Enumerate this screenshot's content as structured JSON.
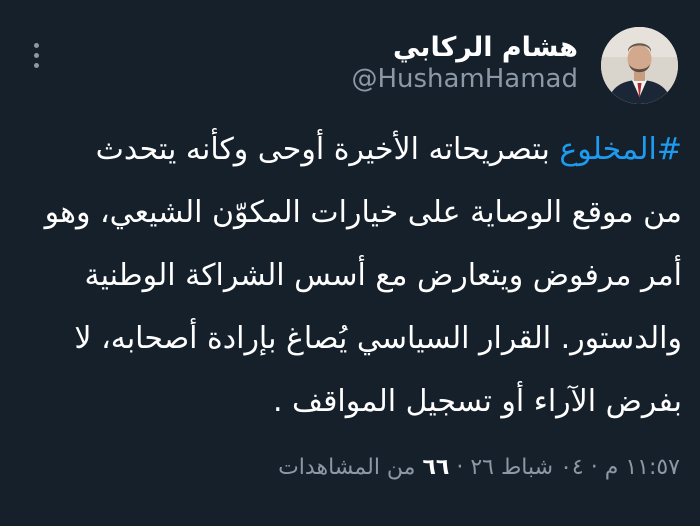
{
  "author": {
    "display_name": "هشام الركابي",
    "handle": "@HushamHamad",
    "avatar_icon": "person-portrait"
  },
  "tweet": {
    "hashtag": "#المخلوع",
    "line1_rest": " بتصريحاته الأخيرة أوحى وكأنه يتحدث",
    "line2": "من موقع الوصاية على خيارات المكوّن الشيعي، وهو",
    "line3": "أمر مرفوض ويتعارض مع أسس الشراكة الوطنية",
    "line4": "والدستور. القرار السياسي يُصاغ بإرادة أصحابه، لا",
    "line5": "بفرض الآراء أو تسجيل المواقف ."
  },
  "meta": {
    "timestamp": "١١:٥٧ م · ٠٤ شباط ٢٦ ·",
    "views_count": "٦٦",
    "views_label": "من المشاهدات"
  },
  "colors": {
    "background": "#15202b",
    "text": "#ffffff",
    "secondary": "#8b98a5",
    "accent": "#1d9bf0"
  }
}
